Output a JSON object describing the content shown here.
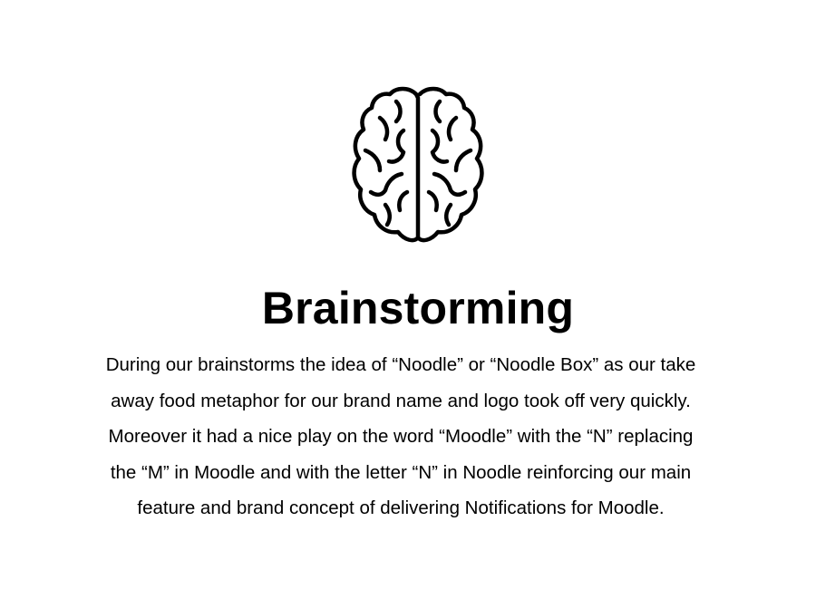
{
  "icon": {
    "name": "brain-icon"
  },
  "title": "Brainstorming",
  "paragraph": {
    "lines": [
      "During our brainstorms the idea of “Noodle” or “Noodle Box” as our take",
      "away food metaphor for our brand name and logo took off very quickly.",
      "Moreover it had a nice play on the word “Moodle” with the “N” replacing",
      "the “M” in Moodle and with the letter “N” in Noodle reinforcing our main",
      "feature and brand concept of delivering Notifications for Moodle."
    ]
  }
}
